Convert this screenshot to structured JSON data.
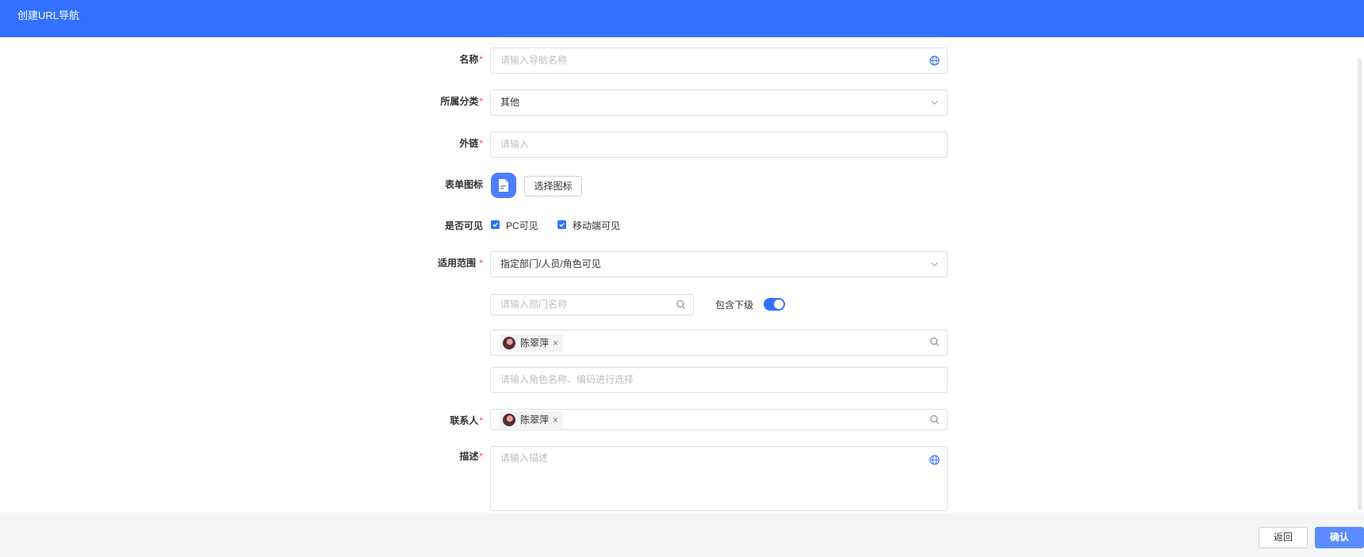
{
  "header": {
    "title": "创建URL导航"
  },
  "form": {
    "name": {
      "label": "名称",
      "required": "*",
      "placeholder": "请输入导航名称"
    },
    "category": {
      "label": "所属分类",
      "required": "*",
      "value": "其他"
    },
    "link": {
      "label": "外链",
      "required": "*",
      "placeholder": "请输入"
    },
    "icon": {
      "label": "表单图标",
      "select_button": "选择图标"
    },
    "visibility": {
      "label": "是否可见",
      "pc_label": "PC可见",
      "pc_checked": true,
      "mobile_label": "移动端可见",
      "mobile_checked": true
    },
    "scope": {
      "label": "适用范围",
      "required": "*",
      "value": "指定部门/人员/角色可见",
      "dept_placeholder": "请输入部门名称",
      "include_sub_label": "包含下级",
      "include_sub_on": true,
      "user_tag": "陈翠萍",
      "role_placeholder": "请输入角色名称、编码进行选择"
    },
    "contact": {
      "label": "联系人",
      "required": "*",
      "user_tag": "陈翠萍"
    },
    "description": {
      "label": "描述",
      "required": "*",
      "placeholder": "请输入描述"
    }
  },
  "footer": {
    "back_label": "返回",
    "confirm_label": "确认"
  },
  "colors": {
    "primary": "#3370ff",
    "required": "#f54a45",
    "footer_bg": "#f4f5f7"
  },
  "icons": {
    "globe": "globe-icon",
    "chevron": "chevron-down-icon",
    "search": "search-icon",
    "form": "document-icon",
    "check": "check-icon",
    "close": "close-icon"
  }
}
